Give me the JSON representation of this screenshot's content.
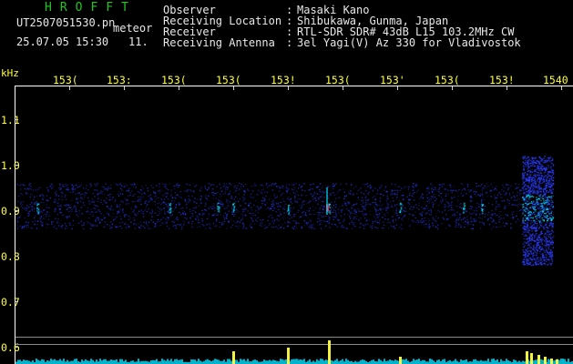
{
  "header": {
    "title": "HROFFT",
    "filename": "UT2507051530.pn",
    "mode_label": "meteor",
    "datetime": "25.07.05 15:30",
    "count": "11.",
    "fields": [
      {
        "label": "Observer",
        "value": "Masaki Kano"
      },
      {
        "label": "Receiving Location",
        "value": "Shibukawa, Gunma, Japan"
      },
      {
        "label": "Receiver",
        "value": "RTL-SDR SDR# 43dB L15 103.2MHz CW"
      },
      {
        "label": "Receiving Antenna",
        "value": "3el Yagi(V) Az 330 for Vladivostok"
      }
    ]
  },
  "axes": {
    "y_unit": "kHz",
    "x_ticks": [
      "153(",
      "153:",
      "153(",
      "153(",
      "153!",
      "153(",
      "153'",
      "153(",
      "153!",
      "1540"
    ],
    "y_ticks": [
      "1.1",
      "1.0",
      "0.9",
      "0.8",
      "0.7",
      "0.6"
    ]
  },
  "colors": {
    "title": "#21c421",
    "tick_labels": "#ffff3c",
    "text": "#e8e8e8",
    "signal_blue": "#2b3cff",
    "signal_cyan": "#00e0ff",
    "meteor_red": "#ff1a4a",
    "bar_yellow": "#ffff40"
  },
  "chart_data": {
    "type": "heatmap",
    "y_unit": "kHz",
    "carrier_band_khz": [
      0.86,
      0.96
    ],
    "meteor_echoes": [
      {
        "time": "15:39",
        "freq_khz_range": [
          0.78,
          1.02
        ],
        "intensity": "strong"
      },
      {
        "time": "15:35",
        "freq_khz": 0.905,
        "intensity": "peak"
      }
    ]
  }
}
